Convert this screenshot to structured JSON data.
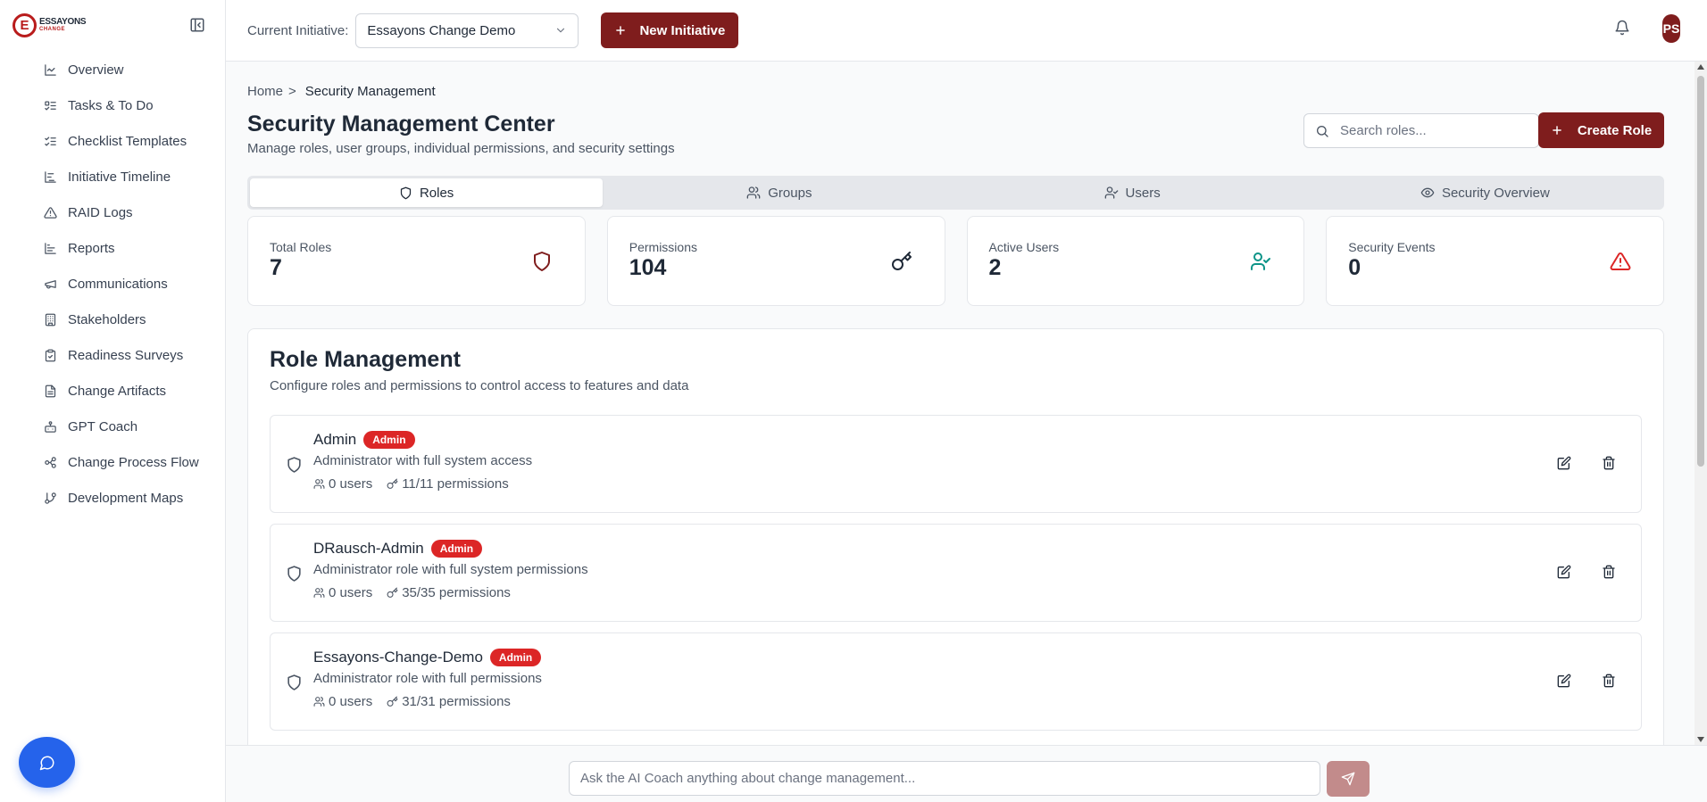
{
  "brand": {
    "logo_letter": "E",
    "line1": "ESSAYONS",
    "line2": "CHANGE"
  },
  "sidebar": {
    "items": [
      {
        "label": "Overview",
        "icon": "line-chart-icon"
      },
      {
        "label": "Tasks & To Do",
        "icon": "list-todo-icon"
      },
      {
        "label": "Checklist Templates",
        "icon": "list-checks-icon"
      },
      {
        "label": "Initiative Timeline",
        "icon": "gantt-icon"
      },
      {
        "label": "RAID Logs",
        "icon": "warning-triangle-icon"
      },
      {
        "label": "Reports",
        "icon": "bar-chart-icon"
      },
      {
        "label": "Communications",
        "icon": "megaphone-icon"
      },
      {
        "label": "Stakeholders",
        "icon": "building-icon"
      },
      {
        "label": "Readiness Surveys",
        "icon": "clipboard-check-icon"
      },
      {
        "label": "Change Artifacts",
        "icon": "file-text-icon"
      },
      {
        "label": "GPT Coach",
        "icon": "bot-icon"
      },
      {
        "label": "Change Process Flow",
        "icon": "flow-icon"
      },
      {
        "label": "Development Maps",
        "icon": "git-branch-icon"
      }
    ]
  },
  "topbar": {
    "current_initiative_label": "Current Initiative:",
    "current_initiative_value": "Essayons Change Demo",
    "new_initiative_label": "New Initiative",
    "avatar_initials": "PS"
  },
  "breadcrumb": {
    "home": "Home",
    "separator": ">",
    "current": "Security Management"
  },
  "page": {
    "title": "Security Management Center",
    "subtitle": "Manage roles, user groups, individual permissions, and security settings",
    "search_placeholder": "Search roles...",
    "create_role_label": "Create Role"
  },
  "tabs": [
    {
      "label": "Roles",
      "icon": "shield-icon",
      "active": true
    },
    {
      "label": "Groups",
      "icon": "users-icon",
      "active": false
    },
    {
      "label": "Users",
      "icon": "user-check-icon",
      "active": false
    },
    {
      "label": "Security Overview",
      "icon": "eye-icon",
      "active": false
    }
  ],
  "stats": [
    {
      "label": "Total Roles",
      "value": "7",
      "icon": "shield-icon",
      "color": "#7f1d1d"
    },
    {
      "label": "Permissions",
      "value": "104",
      "icon": "key-icon",
      "color": "#1f2937"
    },
    {
      "label": "Active Users",
      "value": "2",
      "icon": "user-check-icon",
      "color": "#0d9488"
    },
    {
      "label": "Security Events",
      "value": "0",
      "icon": "alert-triangle-icon",
      "color": "#dc2626"
    }
  ],
  "role_panel": {
    "title": "Role Management",
    "subtitle": "Configure roles and permissions to control access to features and data",
    "roles": [
      {
        "name": "Admin",
        "badge": "Admin",
        "description": "Administrator with full system access",
        "users": "0 users",
        "permissions": "11/11 permissions"
      },
      {
        "name": "DRausch-Admin",
        "badge": "Admin",
        "description": "Administrator role with full system permissions",
        "users": "0 users",
        "permissions": "35/35 permissions"
      },
      {
        "name": "Essayons-Change-Demo",
        "badge": "Admin",
        "description": "Administrator role with full permissions",
        "users": "0 users",
        "permissions": "31/31 permissions"
      }
    ]
  },
  "ai_bar": {
    "placeholder": "Ask the AI Coach anything about change management..."
  }
}
